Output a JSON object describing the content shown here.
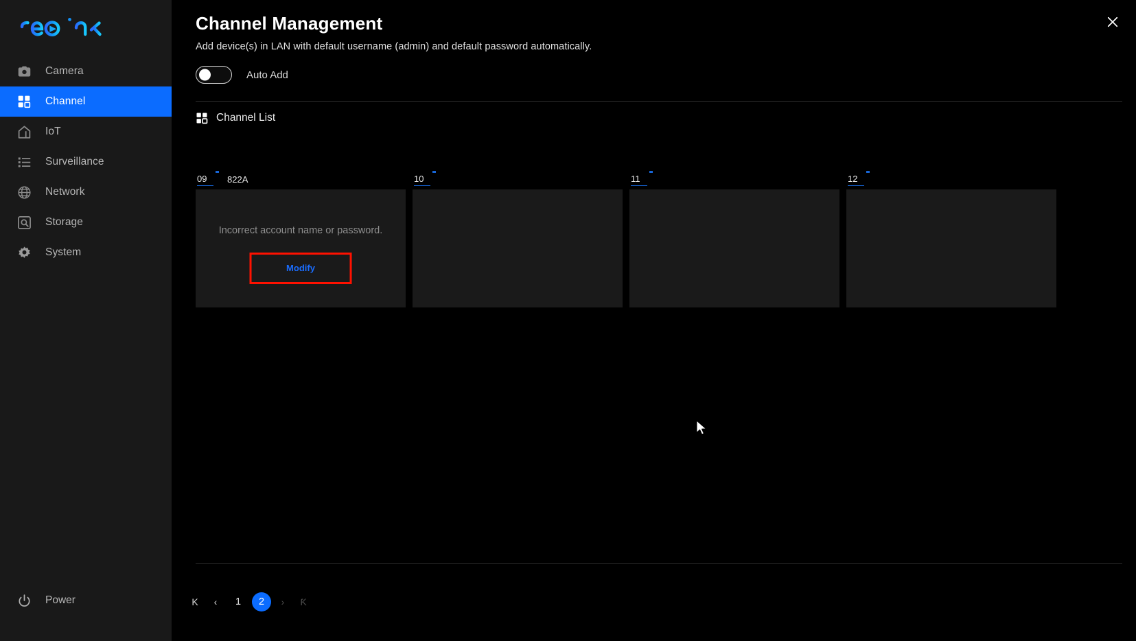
{
  "colors": {
    "accent_blue": "#0b6cff",
    "link_blue": "#1a6dff",
    "highlight_red": "#ff1100",
    "sidebar_bg": "#191919",
    "page_bg": "#000000",
    "tile_bg": "#1a1a1a",
    "underline_blue": "#1565d8"
  },
  "sidebar": {
    "logo_text": "reolink",
    "items": [
      {
        "label": "Camera",
        "icon": "camera-icon",
        "active": false
      },
      {
        "label": "Channel",
        "icon": "grid-icon",
        "active": true
      },
      {
        "label": "IoT",
        "icon": "home-icon",
        "active": false
      },
      {
        "label": "Surveillance",
        "icon": "list-icon",
        "active": false
      },
      {
        "label": "Network",
        "icon": "globe-icon",
        "active": false
      },
      {
        "label": "Storage",
        "icon": "hard-drive-icon",
        "active": false
      },
      {
        "label": "System",
        "icon": "gear-icon",
        "active": false
      }
    ],
    "power": {
      "label": "Power",
      "icon": "power-icon"
    }
  },
  "header": {
    "title": "Channel Management",
    "subtitle": "Add device(s) in LAN with default username (admin) and default password automatically.",
    "close_icon": "close-icon"
  },
  "auto_add": {
    "label": "Auto Add",
    "enabled": false
  },
  "channel_list": {
    "section_label": "Channel List",
    "section_icon": "grid-icon",
    "tiles": [
      {
        "number": "09",
        "name": "822A",
        "status_text": "Incorrect account name or password.",
        "action_label": "Modify",
        "has_error": true,
        "highlighted": true
      },
      {
        "number": "10",
        "name": "",
        "status_text": "",
        "action_label": "",
        "has_error": false,
        "highlighted": false
      },
      {
        "number": "11",
        "name": "",
        "status_text": "",
        "action_label": "",
        "has_error": false,
        "highlighted": false
      },
      {
        "number": "12",
        "name": "",
        "status_text": "",
        "action_label": "",
        "has_error": false,
        "highlighted": false
      }
    ]
  },
  "pagination": {
    "first_label": "K",
    "prev_label": "‹",
    "next_label": "›",
    "last_label": "Ƙ",
    "pages": [
      {
        "label": "1",
        "active": false
      },
      {
        "label": "2",
        "active": true
      }
    ],
    "current_page": 2,
    "next_disabled": true,
    "last_disabled": true
  }
}
